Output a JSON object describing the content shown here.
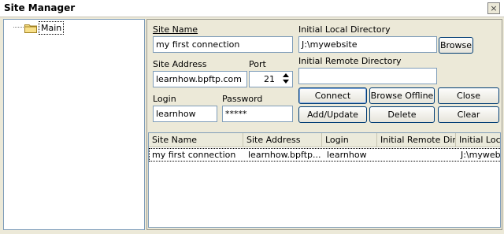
{
  "window": {
    "title": "Site Manager",
    "close_glyph": "×"
  },
  "tree": {
    "items": [
      {
        "label": "Main",
        "icon": "folder-icon"
      }
    ]
  },
  "form": {
    "site_name_label": "Site Name",
    "site_name_value": "my first connection",
    "site_address_label": "Site Address",
    "site_address_value": "learnhow.bpftp.com",
    "port_label": "Port",
    "port_value": "21",
    "login_label": "Login",
    "login_value": "learnhow",
    "password_label": "Password",
    "password_value": "*****",
    "local_dir_label": "Initial Local Directory",
    "local_dir_value": "J:\\mywebsite",
    "remote_dir_label": "Initial Remote Directory",
    "remote_dir_value": ""
  },
  "buttons": {
    "browse": "Browse",
    "connect": "Connect",
    "browse_offline": "Browse Offline",
    "close": "Close",
    "add_update": "Add/Update",
    "delete": "Delete",
    "clear": "Clear"
  },
  "table": {
    "columns": [
      "Site Name",
      "Site Address",
      "Login",
      "Initial Remote Dir",
      "Initial Loca"
    ],
    "rows": [
      [
        "my first connection",
        "learnhow.bpftp...",
        "learnhow",
        "",
        "J:\\mywebsi"
      ]
    ]
  }
}
